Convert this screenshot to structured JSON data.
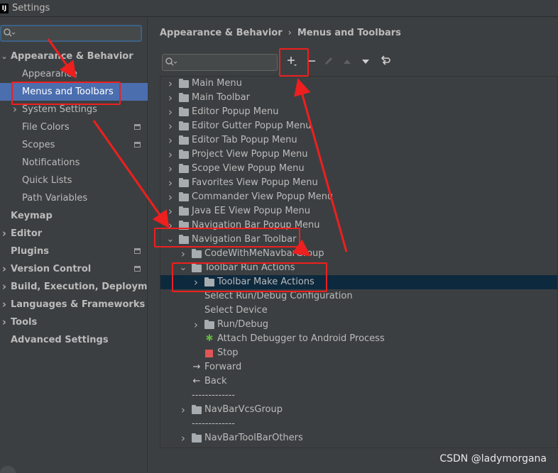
{
  "window": {
    "title": "Settings",
    "logo_letter": "IJ"
  },
  "sidebar": {
    "search": {
      "placeholder": ""
    },
    "items": [
      {
        "label": "Appearance & Behavior",
        "bold": true,
        "expanded": true
      },
      {
        "label": "Appearance"
      },
      {
        "label": "Menus and Toolbars",
        "selected": true
      },
      {
        "label": "System Settings",
        "collapsed": true
      },
      {
        "label": "File Colors",
        "badge": true
      },
      {
        "label": "Scopes",
        "badge": true
      },
      {
        "label": "Notifications"
      },
      {
        "label": "Quick Lists"
      },
      {
        "label": "Path Variables"
      },
      {
        "label": "Keymap",
        "bold": true
      },
      {
        "label": "Editor",
        "bold": true,
        "collapsed": true
      },
      {
        "label": "Plugins",
        "bold": true,
        "badge": true
      },
      {
        "label": "Version Control",
        "bold": true,
        "collapsed": true,
        "badge": true
      },
      {
        "label": "Build, Execution, Deployment",
        "bold": true,
        "collapsed": true
      },
      {
        "label": "Languages & Frameworks",
        "bold": true,
        "collapsed": true
      },
      {
        "label": "Tools",
        "bold": true,
        "collapsed": true
      },
      {
        "label": "Advanced Settings",
        "bold": true
      }
    ]
  },
  "breadcrumb": {
    "parent": "Appearance & Behavior",
    "separator": "›",
    "current": "Menus and Toolbars"
  },
  "toolbar": {
    "search_placeholder": "",
    "buttons": [
      {
        "name": "add",
        "icon": "plus-icon",
        "enabled": true
      },
      {
        "name": "remove",
        "icon": "minus-icon",
        "enabled": true
      },
      {
        "name": "edit",
        "icon": "pencil-icon",
        "enabled": false
      },
      {
        "name": "move-up",
        "icon": "arrow-up-icon",
        "enabled": false
      },
      {
        "name": "move-down",
        "icon": "arrow-down-icon",
        "enabled": true
      },
      {
        "name": "restore",
        "icon": "restore-icon",
        "enabled": true
      }
    ]
  },
  "tree": {
    "rows": [
      {
        "label": "Main Menu",
        "type": "folder",
        "chevron": "right",
        "level": 0
      },
      {
        "label": "Main Toolbar",
        "type": "folder",
        "chevron": "right",
        "level": 0
      },
      {
        "label": "Editor Popup Menu",
        "type": "folder",
        "chevron": "right",
        "level": 0
      },
      {
        "label": "Editor Gutter Popup Menu",
        "type": "folder",
        "chevron": "right",
        "level": 0
      },
      {
        "label": "Editor Tab Popup Menu",
        "type": "folder",
        "chevron": "right",
        "level": 0
      },
      {
        "label": "Project View Popup Menu",
        "type": "folder",
        "chevron": "right",
        "level": 0
      },
      {
        "label": "Scope View Popup Menu",
        "type": "folder",
        "chevron": "right",
        "level": 0
      },
      {
        "label": "Favorites View Popup Menu",
        "type": "folder",
        "chevron": "right",
        "level": 0
      },
      {
        "label": "Commander View Popup Menu",
        "type": "folder",
        "chevron": "right",
        "level": 0
      },
      {
        "label": "Java EE View Popup Menu",
        "type": "folder",
        "chevron": "right",
        "level": 0
      },
      {
        "label": "Navigation Bar Popup Menu",
        "type": "folder",
        "chevron": "right",
        "level": 0
      },
      {
        "label": "Navigation Bar Toolbar",
        "type": "folder",
        "chevron": "down",
        "level": 0
      },
      {
        "label": "CodeWithMeNavbarGroup",
        "type": "folder",
        "chevron": "right",
        "level": 1
      },
      {
        "label": "Toolbar Run Actions",
        "type": "folder",
        "chevron": "down",
        "level": 1
      },
      {
        "label": "Toolbar Make Actions",
        "type": "folder",
        "chevron": "right",
        "level": 2,
        "selected": true
      },
      {
        "label": "Select Run/Debug Configuration",
        "type": "plain",
        "level": 2
      },
      {
        "label": "Select Device",
        "type": "plain",
        "level": 2
      },
      {
        "label": "Run/Debug",
        "type": "folder",
        "chevron": "right",
        "level": 2
      },
      {
        "label": "Attach Debugger to Android Process",
        "type": "bug",
        "level": 2
      },
      {
        "label": "Stop",
        "type": "stop",
        "level": 2
      },
      {
        "label": "Forward",
        "type": "forward",
        "level": 1
      },
      {
        "label": "Back",
        "type": "back",
        "level": 1
      },
      {
        "label": "-------------",
        "type": "separator",
        "level": 1
      },
      {
        "label": "NavBarVcsGroup",
        "type": "folder",
        "chevron": "right",
        "level": 1
      },
      {
        "label": "-------------",
        "type": "separator",
        "level": 1
      },
      {
        "label": "NavBarToolBarOthers",
        "type": "folder",
        "chevron": "right",
        "level": 1
      }
    ]
  },
  "watermark": "CSDN @ladymorgana",
  "colors": {
    "annotation_red": "#ee1f1f",
    "selection_blue": "#4b6eaf",
    "tree_selection": "#0d293e"
  }
}
